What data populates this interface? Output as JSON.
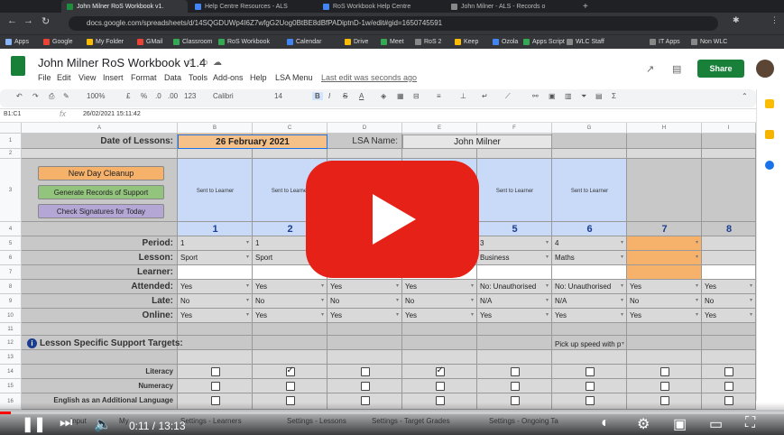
{
  "browser": {
    "tabs": [
      {
        "title": "John Milner RoS Workbook v1.",
        "active": true,
        "color": "#1e8e3e"
      },
      {
        "title": "Help Centre Resources - ALS",
        "color": "#4285f4"
      },
      {
        "title": "RoS Workbook Help Centre",
        "color": "#4285f4"
      },
      {
        "title": "John Milner - ALS - Records o",
        "color": "#888888"
      }
    ],
    "url": "docs.google.com/spreadsheets/d/14SQGDUWp4I6Z7wfgG2Uog0BtBE8dBfPADiptnD-1w/edit#gid=1650745591",
    "bookmarks": [
      "Apps",
      "Google",
      "My Folder",
      "GMail",
      "Classroom",
      "RoS Workbook",
      "Calendar",
      "Drive",
      "Meet",
      "RoS 2",
      "Keep",
      "Ozola",
      "Apps Script",
      "WLC Staff",
      "IT Apps",
      "Non WLC"
    ]
  },
  "sheets": {
    "title": "John Milner RoS Workbook v1.4",
    "menu": [
      "File",
      "Edit",
      "View",
      "Insert",
      "Format",
      "Data",
      "Tools",
      "Add-ons",
      "Help",
      "LSA Menu"
    ],
    "last_edit": "Last edit was seconds ago",
    "share": "Share",
    "toolbar": {
      "zoom": "100%",
      "currency": "£",
      "percent": "%",
      "dec1": ".0",
      "dec2": ".00",
      "format": "123",
      "font": "Calibri",
      "size": "14"
    },
    "namebox": "B1:C1",
    "formula": "26/02/2021 15:11:42",
    "columns": [
      "A",
      "B",
      "C",
      "D",
      "E",
      "F",
      "G",
      "H",
      "I"
    ],
    "rows": [
      "1",
      "2",
      "3",
      "4",
      "5",
      "6",
      "7",
      "8",
      "9",
      "10",
      "11",
      "12",
      "13",
      "14",
      "15",
      "16"
    ]
  },
  "grid": {
    "date_label": "Date of Lessons:",
    "date_value": "26 February 2021",
    "lsa_label": "LSA Name:",
    "lsa_value": "John Milner",
    "buttons": {
      "cleanup": "New Day Cleanup",
      "generate": "Generate Records of Support",
      "signatures": "Check Signatures for Today"
    },
    "sent_to_learner": "Sent to Learner",
    "lesson_numbers": [
      "1",
      "2",
      "3",
      "4",
      "5",
      "6",
      "7",
      "8"
    ],
    "row_labels": {
      "period": "Period:",
      "lesson": "Lesson:",
      "learner": "Learner:",
      "attended": "Attended:",
      "late": "Late:",
      "online": "Online:"
    },
    "period": [
      "1",
      "1",
      "",
      "",
      "3",
      "4",
      "",
      ""
    ],
    "lesson": [
      "Sport",
      "Sport",
      "",
      "",
      "Business",
      "Maths",
      "",
      ""
    ],
    "attended": [
      "Yes",
      "Yes",
      "Yes",
      "Yes",
      "No: Unauthorised",
      "No: Unauthorised",
      "Yes",
      "Yes"
    ],
    "late": [
      "No",
      "No",
      "No",
      "No",
      "N/A",
      "N/A",
      "No",
      "No"
    ],
    "online": [
      "Yes",
      "Yes",
      "Yes",
      "Yes",
      "Yes",
      "Yes",
      "Yes",
      "Yes"
    ],
    "targets_label": "Lesson Specific Support Targets:",
    "target_note": "Pick up speed with p",
    "support_rows": [
      {
        "label": "Literacy",
        "checked": [
          false,
          true,
          false,
          true,
          false,
          false,
          false,
          false
        ]
      },
      {
        "label": "Numeracy",
        "checked": [
          false,
          false,
          false,
          false,
          false,
          false,
          false,
          false
        ]
      },
      {
        "label": "English as an Additional Language",
        "checked": [
          false,
          false,
          false,
          false,
          false,
          false,
          false,
          false
        ]
      }
    ]
  },
  "sheet_tabs": [
    "Input",
    "My",
    "Settings - Learners",
    "Settings - Lessons",
    "Settings - Target Grades",
    "Settings - Ongoing Ta"
  ],
  "video": {
    "current": "0:11",
    "total": "13:13",
    "progress": 0.014
  }
}
